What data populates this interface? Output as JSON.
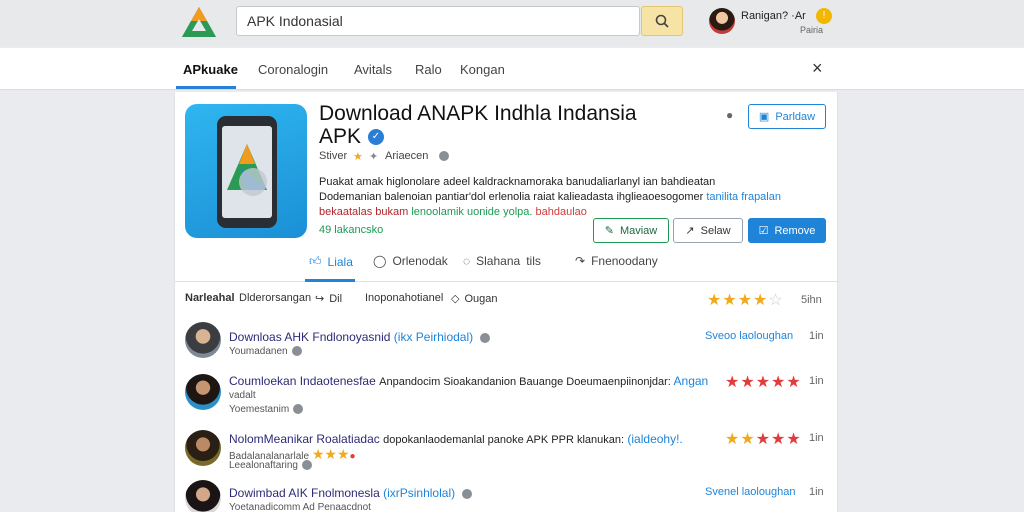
{
  "header": {
    "search_value": "APK Indonasial",
    "user_name": "Ranigan? ·Ar",
    "user_sub": "Pairia",
    "badge": "!"
  },
  "nav": {
    "items": [
      "APkuake",
      "Coronalogin",
      "Avitals",
      "Ralo",
      "Kongan"
    ],
    "active_index": 0,
    "close": "×"
  },
  "app": {
    "title": "Download ANAPK Indhla Indansia",
    "title_line2": "APK",
    "verified": "✓",
    "developer": "Stiver",
    "category": "Ariaecen",
    "desc_line1": "Puakat amak higlonolare adeel kaldracknamoraka banudaliarlanyl ian bahdieatan",
    "desc_line2_a": "Dodemanian balenoian pantiar'dol erlenolia raiat kalieadasta ihglieaoesogomer",
    "desc_line2_b": "tanilita frapalan",
    "desc_line3_a": "bekaatalas bukam",
    "desc_line3_b": "lenoolamik uonide yolpa.",
    "desc_line3_c": "bahdaulao",
    "desc_line4": "49 lakancsko",
    "buttons": {
      "save": "Parldaw",
      "review": "Maviaw",
      "share": "Selaw",
      "remove": "Remove"
    }
  },
  "tabs": [
    "Liala",
    "Orlenodak",
    "Slahana",
    "tils",
    "Fnenoodany"
  ],
  "review_bar": {
    "sort_label": "Narleahal",
    "filter1": "Dlderorsangan",
    "filter2": "Dil",
    "filter3": "Inoponahotianel",
    "filter4": "Ougan",
    "rating_count": "5ihn",
    "stars_filled": 4
  },
  "reviews": [
    {
      "title": "Downloas AHK Fndlonoyasnid",
      "title_tag": "(ikx Peirhiodal)",
      "sub": "Youmadanen",
      "right_tag": "Sveoo laoloughan",
      "time": "1in",
      "stars": 0
    },
    {
      "title": "Coumloekan Indaotenesfae",
      "title_tail": "Anpandocim Sioakandanion Bauange Doeumaenpiinonjdar:",
      "title_tag": "Angan",
      "sub": "vadalt",
      "sub2": "Yoemestanim",
      "right_tag": "",
      "time": "1in",
      "stars": 5
    },
    {
      "title": "NolomMeanikar Roalatiadac",
      "title_tail": "dopokanlaodemanlal panoke APK PPR klanukan:",
      "title_tag": "(ialdeohy!.",
      "sub": "Badalanalanarlale",
      "sub2": "Leealonaftaring",
      "right_tag": "",
      "time": "1in",
      "stars": 5
    },
    {
      "title": "Dowimbad AIK Fnolmonesla",
      "title_tag": "(ixrPsinhlolal)",
      "sub": "Yoetanadicomm Ad Penaacdnot",
      "right_tag": "Svenel laoloughan",
      "time": "1in",
      "stars": 0
    }
  ],
  "colors": {
    "accent": "#1f84d8",
    "search_button": "#f6e3a6",
    "review_title": "#2e2a78",
    "star": "#f2a91d",
    "star_red": "#e23b3b"
  }
}
